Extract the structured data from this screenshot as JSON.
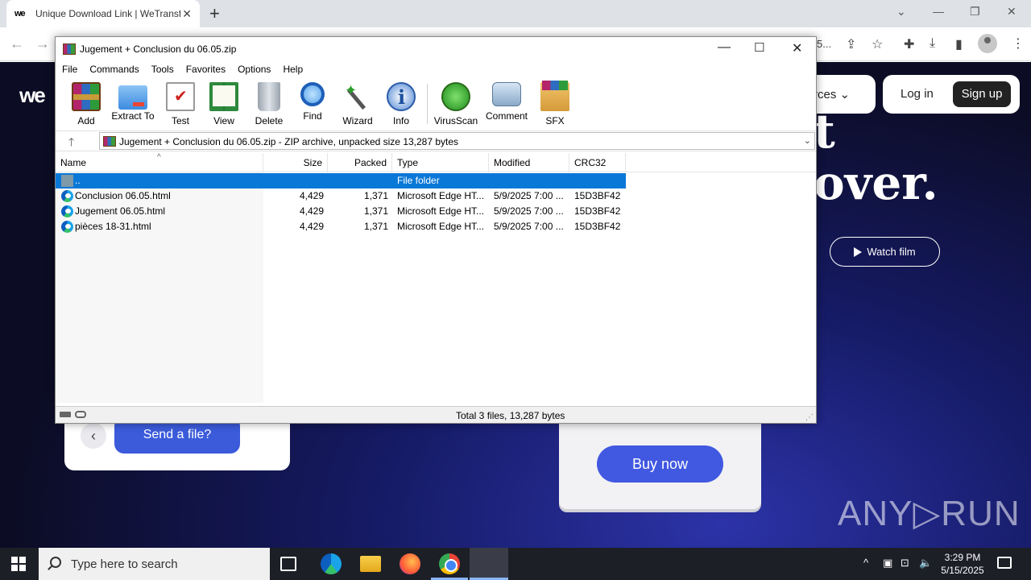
{
  "browser": {
    "tab_title": "Unique Download Link | WeTransfer",
    "tab_favicon": "we",
    "new_tab": "+",
    "tab_close": "✕",
    "address_partial": "5..."
  },
  "site": {
    "logo": "we",
    "resources_label": "rces ⌄",
    "login": "Log in",
    "signup": "Sign up",
    "hero_line1": "t",
    "hero_line2": "over.",
    "watch_film": "Watch film",
    "send_file": "Send a file?",
    "buy_now": "Buy now",
    "watermark": "ANY▷RUN"
  },
  "winrar": {
    "title": "Jugement + Conclusion du 06.05.zip",
    "menu": [
      "File",
      "Commands",
      "Tools",
      "Favorites",
      "Options",
      "Help"
    ],
    "tools": [
      "Add",
      "Extract To",
      "Test",
      "View",
      "Delete",
      "Find",
      "Wizard",
      "Info",
      "VirusScan",
      "Comment",
      "SFX"
    ],
    "path": "Jugement + Conclusion du 06.05.zip - ZIP archive, unpacked size 13,287 bytes",
    "columns": [
      "Name",
      "Size",
      "Packed",
      "Type",
      "Modified",
      "CRC32"
    ],
    "rows": [
      {
        "name": "..",
        "size": "",
        "packed": "",
        "type": "File folder",
        "modified": "",
        "crc": ""
      },
      {
        "name": "Conclusion 06.05.html",
        "size": "4,429",
        "packed": "1,371",
        "type": "Microsoft Edge HT...",
        "modified": "5/9/2025 7:00 ...",
        "crc": "15D3BF42"
      },
      {
        "name": "Jugement 06.05.html",
        "size": "4,429",
        "packed": "1,371",
        "type": "Microsoft Edge HT...",
        "modified": "5/9/2025 7:00 ...",
        "crc": "15D3BF42"
      },
      {
        "name": "pièces 18-31.html",
        "size": "4,429",
        "packed": "1,371",
        "type": "Microsoft Edge HT...",
        "modified": "5/9/2025 7:00 ...",
        "crc": "15D3BF42"
      }
    ],
    "status": "Total 3 files, 13,287 bytes"
  },
  "taskbar": {
    "search_placeholder": "Type here to search",
    "time": "3:29 PM",
    "date": "5/15/2025"
  }
}
